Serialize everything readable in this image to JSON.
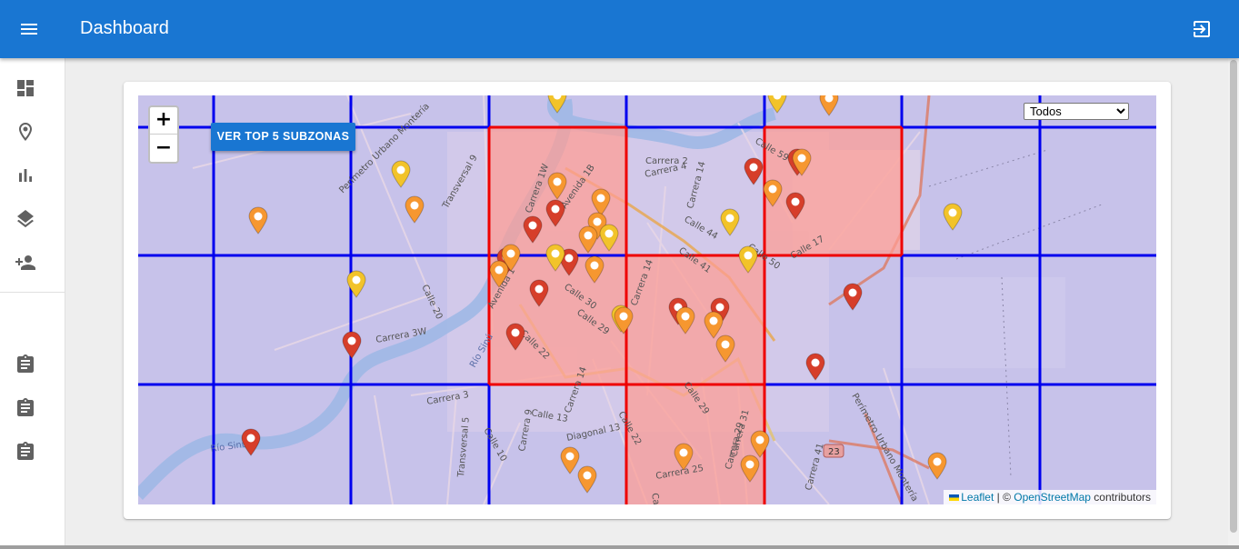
{
  "appbar": {
    "title": "Dashboard",
    "menu_icon": "menu-icon",
    "logout_icon": "logout-icon"
  },
  "drawer": {
    "items": [
      {
        "icon": "dashboard-icon"
      },
      {
        "icon": "location-pin-icon"
      },
      {
        "icon": "bar-chart-icon"
      },
      {
        "icon": "layers-icon"
      },
      {
        "icon": "add-person-icon"
      },
      {
        "icon": "clipboard-icon"
      },
      {
        "icon": "clipboard-icon"
      },
      {
        "icon": "clipboard-icon"
      }
    ]
  },
  "map": {
    "zoom_in": "+",
    "zoom_out": "−",
    "top_button": "VER TOP 5 SUBZONAS",
    "filter": {
      "selected": "Todos",
      "options": [
        "Todos"
      ]
    },
    "attribution": {
      "leaflet": "Leaflet",
      "sep": " | © ",
      "osm": "OpenStreetMap",
      "suffix": " contributors"
    },
    "street_labels": [
      "Carrera 2",
      "Carrera 4",
      "Calle 59",
      "Calle 44",
      "Calle 50",
      "Calle 41",
      "Calle 17",
      "Calle 30",
      "Calle 29",
      "Calle 22",
      "Carrera 14",
      "Calle 29",
      "Carrera 3W",
      "Calle 20",
      "Transversal 9",
      "Perímetro Urbano Montería",
      "Río Sinú",
      "Carrera 3",
      "Calle 13",
      "Carrera 14",
      "Calle 22",
      "Diagonal 13",
      "Calle 10",
      "Carrera 9",
      "Transversal 5",
      "Carrera 25",
      "Calle 22",
      "Carrera 29",
      "Carrera 31",
      "Carrera 41",
      "Perímetro Urbano Montería",
      "Avenida 1",
      "Carrera 1W",
      "Avenida 1B",
      "Carrera 14",
      "23",
      "Río Sinú"
    ],
    "colors": {
      "grid_blue": "#0000ee",
      "hot_red": "#ee0000",
      "marker_red": "#d63e2a",
      "marker_orange": "#f69730",
      "marker_yellow": "#f2c32a",
      "appbar": "#1976d2"
    }
  }
}
